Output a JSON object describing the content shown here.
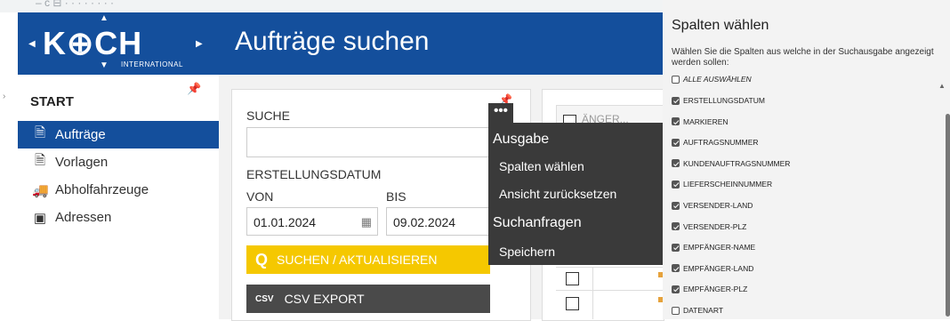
{
  "browser": {
    "ghost_text": "– ᴄ  ⊟   ·   ·   ·   ·   ·   ·   ·   ·"
  },
  "logo": {
    "brand": "K⊕CH",
    "subtitle": "INTERNATIONAL"
  },
  "header": {
    "title": "Aufträge suchen"
  },
  "sidebar": {
    "heading": "START",
    "items": [
      {
        "label": "Aufträge",
        "icon": "document-icon",
        "active": true
      },
      {
        "label": "Vorlagen",
        "icon": "template-icon",
        "active": false
      },
      {
        "label": "Abholfahrzeuge",
        "icon": "truck-icon",
        "active": false
      },
      {
        "label": "Adressen",
        "icon": "address-card-icon",
        "active": false
      }
    ]
  },
  "search": {
    "suche_label": "SUCHE",
    "suche_value": "",
    "date_section_label": "ERSTELLUNGSDATUM",
    "von_label": "VON",
    "bis_label": "BIS",
    "von_value": "01.01.2024",
    "bis_value": "09.02.2024",
    "search_button": "SUCHEN / AKTUALISIEREN",
    "csv_button": "CSV EXPORT",
    "csv_icon_text": "CSV",
    "more_button": "•••"
  },
  "menu": {
    "section1": "Ausgabe",
    "item1": "Spalten wählen",
    "item2": "Ansicht zurücksetzen",
    "section2": "Suchanfragen",
    "item3": "Speichern"
  },
  "table": {
    "header_partial": "ÄNGER..."
  },
  "panel": {
    "title": "Spalten wählen",
    "description": "Wählen Sie die Spalten aus welche in der Suchausgabe angezeigt werden sollen:",
    "select_all": "ALLE AUSWÄHLEN",
    "options": [
      {
        "label": "ERSTELLUNGSDATUM",
        "checked": true
      },
      {
        "label": "MARKIEREN",
        "checked": true
      },
      {
        "label": "AUFTRAGSNUMMER",
        "checked": true
      },
      {
        "label": "KUNDENAUFTRAGSNUMMER",
        "checked": true
      },
      {
        "label": "LIEFERSCHEINNUMMER",
        "checked": true
      },
      {
        "label": "VERSENDER-LAND",
        "checked": true
      },
      {
        "label": "VERSENDER-PLZ",
        "checked": true
      },
      {
        "label": "EMPFÄNGER-NAME",
        "checked": true
      },
      {
        "label": "EMPFÄNGER-LAND",
        "checked": true
      },
      {
        "label": "EMPFÄNGER-PLZ",
        "checked": true
      },
      {
        "label": "DATENART",
        "checked": false
      }
    ]
  },
  "colors": {
    "primary": "#144f9c",
    "accent": "#f5c800",
    "dark": "#3a3a3a"
  }
}
